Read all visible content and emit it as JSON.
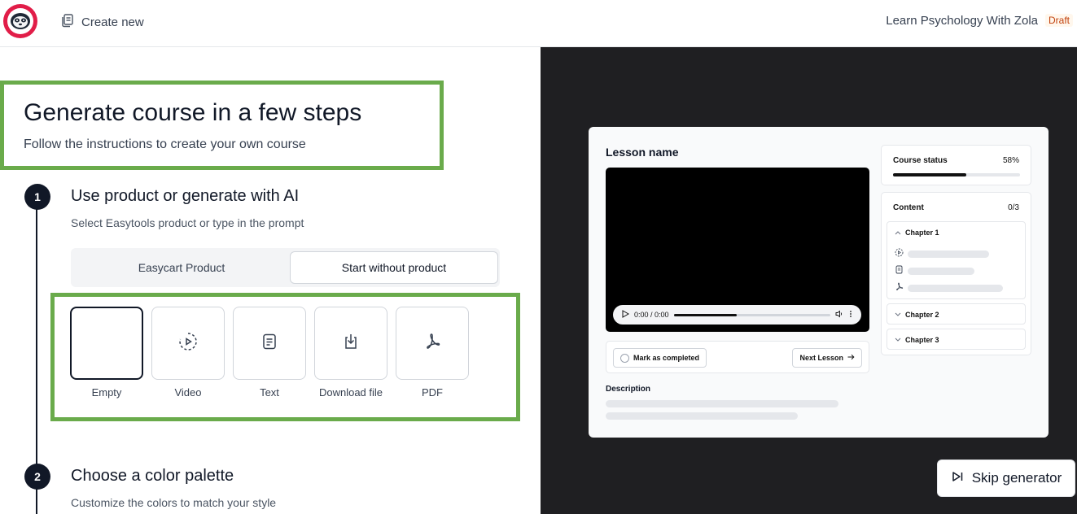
{
  "header": {
    "create_new_label": "Create new",
    "course_name": "Learn Psychology With Zola",
    "status_badge": "Draft"
  },
  "intro": {
    "title": "Generate course in a few steps",
    "subtitle": "Follow the instructions to create your own course"
  },
  "steps": [
    {
      "number": "1",
      "title": "Use product or generate with AI",
      "description": "Select Easytools product or type in the prompt",
      "toggle": {
        "option_a": "Easycart Product",
        "option_b": "Start without product",
        "selected": "option_b"
      },
      "types": [
        {
          "label": "Empty",
          "icon": "empty",
          "selected": true
        },
        {
          "label": "Video",
          "icon": "video-icon"
        },
        {
          "label": "Text",
          "icon": "document-icon"
        },
        {
          "label": "Download file",
          "icon": "download-icon"
        },
        {
          "label": "PDF",
          "icon": "pdf-icon"
        }
      ]
    },
    {
      "number": "2",
      "title": "Choose a color palette",
      "description": "Customize the colors to match your style"
    }
  ],
  "preview": {
    "lesson_name": "Lesson name",
    "video_time": "0:00 / 0:00",
    "video_progress_fraction": 0.4,
    "mark_completed_label": "Mark as completed",
    "next_lesson_label": "Next Lesson",
    "description_label": "Description",
    "course_status_label": "Course status",
    "course_status_percent": "58%",
    "course_status_fraction": 0.58,
    "content_label": "Content",
    "content_count": "0/3",
    "chapters": [
      {
        "name": "Chapter 1",
        "expanded": true
      },
      {
        "name": "Chapter 2",
        "expanded": false
      },
      {
        "name": "Chapter 3",
        "expanded": false
      }
    ]
  },
  "skip_label": "Skip generator",
  "colors": {
    "highlight_green": "#6aab4b",
    "logo_red": "#e11d48",
    "dark_panel": "#1f1f22",
    "draft_orange": "#c2410c"
  }
}
